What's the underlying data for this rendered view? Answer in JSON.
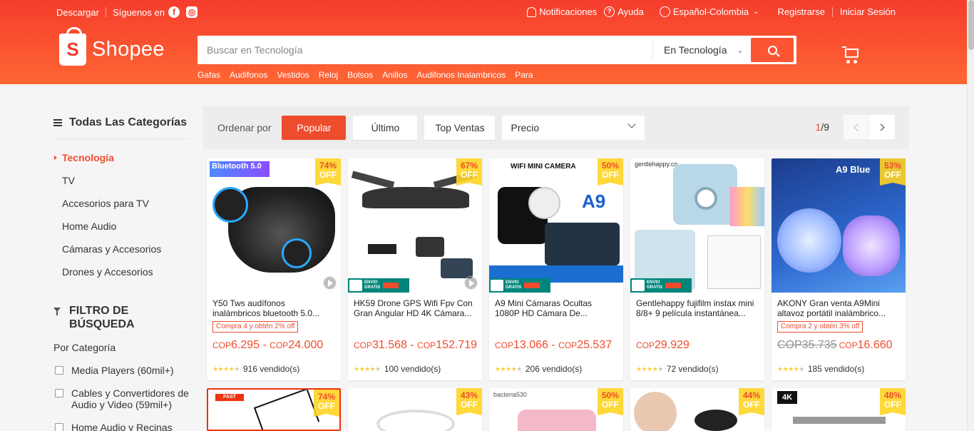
{
  "topbar": {
    "download": "Descargar",
    "follow": "Síguenos en",
    "notifications": "Notificaciones",
    "help": "Ayuda",
    "language": "Español-Colombia",
    "register": "Registrarse",
    "login": "Iniciar Sesión"
  },
  "logo": {
    "text": "Shopee"
  },
  "search": {
    "placeholder": "Buscar en Tecnología",
    "scope": "En Tecnología"
  },
  "keywords": [
    "Gafas",
    "Audifonos",
    "Vestidos",
    "Reloj",
    "Bolsos",
    "Anillos",
    "Audifonos Inalambricos",
    "Para"
  ],
  "sidebar": {
    "title": "Todas Las Categorías",
    "categories": [
      "Tecnología",
      "TV",
      "Accesorios para TV",
      "Home Audio",
      "Cámaras y Accesorios",
      "Drones y Accesorios"
    ],
    "filter_title": "FILTRO DE BÚSQUEDA",
    "by_category": "Por Categoría",
    "filters": [
      "Media Players (60mil+)",
      "Cables y Convertidores de Audio y Video (59mil+)",
      "Home Audio y Recinas"
    ]
  },
  "sort": {
    "label": "Ordenar por",
    "popular": "Popular",
    "latest": "Último",
    "top_sales": "Top Ventas",
    "price": "Precio",
    "page_current": "1",
    "page_total": "/9"
  },
  "products": [
    {
      "name": "Y50 Tws audífonos inalámbricos bluetooth 5.0...",
      "discount": "74%",
      "off": "OFF",
      "promo": "Compra 4 y obtén 2% off",
      "cur1": "COP",
      "price1": "6.295",
      "sep": " - ",
      "cur2": "COP",
      "price2": "24.000",
      "old": "",
      "sold": "916 vendido(s)",
      "img_label": "Bluetooth 5.0"
    },
    {
      "name": "HK59 Drone GPS Wifi Fpv Con Gran Angular HD 4K Cámara...",
      "discount": "67%",
      "off": "OFF",
      "promo": "",
      "cur1": "COP",
      "price1": "31.568",
      "sep": " - ",
      "cur2": "COP",
      "price2": "152.719",
      "old": "",
      "sold": "100 vendido(s)",
      "img_label": ""
    },
    {
      "name": "A9 Mini Cámaras Ocultas 1080P HD Cámara De...",
      "discount": "50%",
      "off": "OFF",
      "promo": "",
      "cur1": "COP",
      "price1": "13.066",
      "sep": " - ",
      "cur2": "COP",
      "price2": "25.537",
      "old": "",
      "sold": "206 vendido(s)",
      "img_label": "WIFI MINI CAMERA"
    },
    {
      "name": "Gentlehappy fujifilm instax mini 8/8+ 9 película instantánea...",
      "discount": "",
      "off": "",
      "promo": "",
      "cur1": "COP",
      "price1": "29.929",
      "sep": "",
      "cur2": "",
      "price2": "",
      "old": "",
      "sold": "72 vendido(s)",
      "img_label": "gentlehappy.co"
    },
    {
      "name": "AKONY Gran venta A9Mini altavoz portátil inalámbrico...",
      "discount": "53%",
      "off": "OFF",
      "promo": "Compra 2 y obtén 3% off",
      "cur1": "COP",
      "price1": "16.660",
      "sep": "",
      "cur2": "",
      "price2": "",
      "old": "COP35.735",
      "sold": "185 vendido(s)",
      "img_label": "A9 Blue"
    }
  ],
  "row2_discounts": [
    "74%",
    "43%",
    "50%",
    "44%",
    "48%"
  ],
  "row2_labels": [
    "FAST DELIVERY",
    "",
    "bacteria530",
    "",
    "4K"
  ],
  "colors": {
    "brand": "#ee4d2d",
    "header_top": "#f53d2d",
    "header_bottom": "#ff6633"
  }
}
